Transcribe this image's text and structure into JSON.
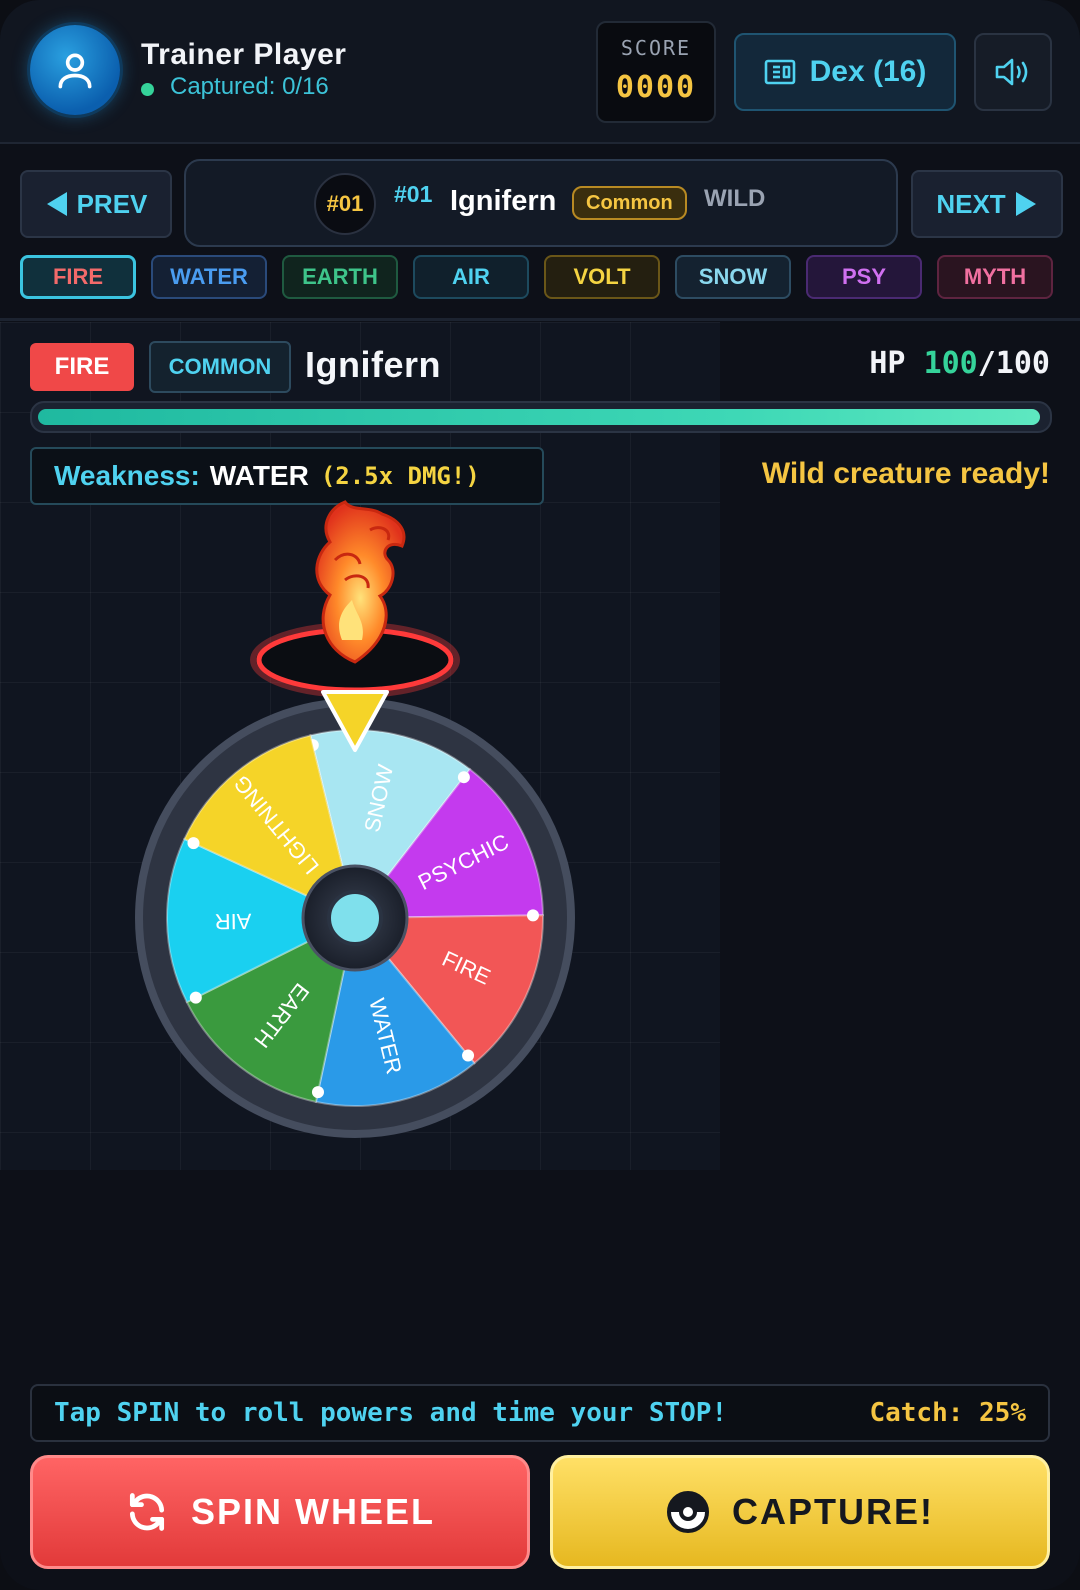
{
  "player": {
    "name": "Trainer Player",
    "captured": "Captured: 0/16"
  },
  "score": {
    "label": "SCORE",
    "value": "0000"
  },
  "dex_button": "Dex (16)",
  "nav": {
    "prev": "PREV",
    "next": "NEXT",
    "number_badge": "#01",
    "number": "#01",
    "name": "Ignifern",
    "rarity": "Common",
    "status": "WILD"
  },
  "type_filters": [
    {
      "label": "FIRE",
      "color": "#f26a6a",
      "bg": "#10303c",
      "border": "#3bc4e0",
      "active": true
    },
    {
      "label": "WATER",
      "color": "#4a9cf0",
      "bg": "#142034",
      "border": "#2a4a7a",
      "active": false
    },
    {
      "label": "EARTH",
      "color": "#3ec48a",
      "bg": "#10241e",
      "border": "#1f5a40",
      "active": false
    },
    {
      "label": "AIR",
      "color": "#4fd2f0",
      "bg": "#10202c",
      "border": "#1d4a5e",
      "active": false
    },
    {
      "label": "VOLT",
      "color": "#f5d442",
      "bg": "#241f10",
      "border": "#6a5618",
      "active": false
    },
    {
      "label": "SNOW",
      "color": "#8ad8ee",
      "bg": "#142230",
      "border": "#2d4c62",
      "active": false
    },
    {
      "label": "PSY",
      "color": "#d070f0",
      "bg": "#24163a",
      "border": "#4a2a72",
      "active": false
    },
    {
      "label": "MYTH",
      "color": "#f070a0",
      "bg": "#2a1420",
      "border": "#5e2440",
      "active": false
    }
  ],
  "creature": {
    "type": "FIRE",
    "rarity": "COMMON",
    "name": "Ignifern",
    "hp_label": "HP",
    "hp_current": "100",
    "hp_max": "/100",
    "hp_fraction": 1.0,
    "weakness_label": "Weakness:",
    "weakness_type": "WATER",
    "weakness_mult": "(2.5x DMG!)",
    "status": "Wild creature ready!"
  },
  "wheel": {
    "segments": [
      {
        "label": "SNOW",
        "color": "#a8e6f2"
      },
      {
        "label": "PSYCHIC",
        "color": "#c43aee"
      },
      {
        "label": "FIRE",
        "color": "#f25656"
      },
      {
        "label": "WATER",
        "color": "#2a9ae8"
      },
      {
        "label": "EARTH",
        "color": "#3a9a3e"
      },
      {
        "label": "AIR",
        "color": "#1ad0f0"
      },
      {
        "label": "LIGHTNING",
        "color": "#f5d428"
      }
    ]
  },
  "tip": "Tap SPIN to roll powers and time your STOP!",
  "catch": "Catch: 25%",
  "buttons": {
    "spin": "SPIN WHEEL",
    "capture": "CAPTURE!"
  }
}
